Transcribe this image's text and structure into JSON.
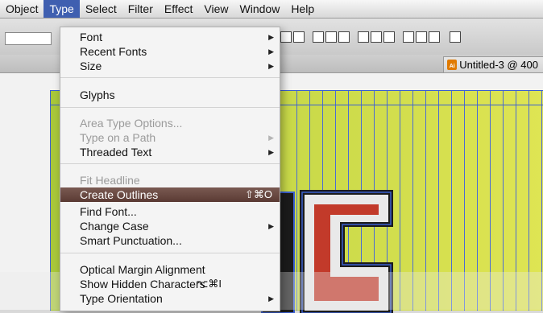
{
  "menubar": {
    "items": [
      {
        "label": "Object",
        "active": false
      },
      {
        "label": "Type",
        "active": true
      },
      {
        "label": "Select",
        "active": false
      },
      {
        "label": "Filter",
        "active": false
      },
      {
        "label": "Effect",
        "active": false
      },
      {
        "label": "View",
        "active": false
      },
      {
        "label": "Window",
        "active": false
      },
      {
        "label": "Help",
        "active": false
      }
    ]
  },
  "document_tab": {
    "title": "Untitled-3 @ 400",
    "icon_text": "Ai"
  },
  "type_menu": {
    "items": [
      {
        "label": "Font",
        "submenu": true
      },
      {
        "label": "Recent Fonts",
        "submenu": true
      },
      {
        "label": "Size",
        "submenu": true
      },
      {
        "label": "Glyphs"
      },
      {
        "label": "Area Type Options...",
        "disabled": true
      },
      {
        "label": "Type on a Path",
        "submenu": true,
        "disabled": true
      },
      {
        "label": "Threaded Text",
        "submenu": true
      },
      {
        "label": "Fit Headline",
        "disabled": true
      },
      {
        "label": "Create Outlines",
        "shortcut": "⇧⌘O",
        "highlighted": true
      },
      {
        "label": "Find Font..."
      },
      {
        "label": "Change Case",
        "submenu": true
      },
      {
        "label": "Smart Punctuation..."
      },
      {
        "label": "Optical Margin Alignment"
      },
      {
        "label": "Show Hidden Characters",
        "shortcut": "⌥⌘I"
      },
      {
        "label": "Type Orientation",
        "submenu": true
      }
    ]
  },
  "colors": {
    "menu_highlight": "#6a4a42",
    "artboard_green": "#c7d848",
    "selection_blue": "#3a5fd0"
  },
  "icons": [
    "chevron-right-icon",
    "ai-file-icon",
    "align-icon"
  ]
}
